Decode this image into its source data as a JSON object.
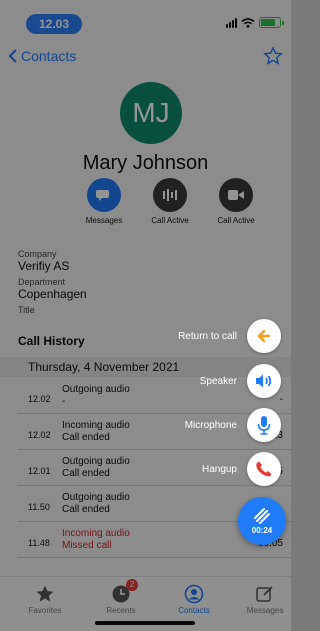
{
  "status": {
    "time": "12.03"
  },
  "nav": {
    "back_label": "Contacts"
  },
  "contact": {
    "initials": "MJ",
    "name": "Mary Johnson",
    "actions": [
      {
        "label": "Messages",
        "icon": "chat-bubble-icon"
      },
      {
        "label": "Call Active",
        "icon": "call-active-icon"
      },
      {
        "label": "Call Active",
        "icon": "video-icon"
      }
    ],
    "fields": [
      {
        "label": "Company",
        "value": "Verifiy AS"
      },
      {
        "label": "Department",
        "value": "Copenhagen"
      },
      {
        "label": "Title",
        "value": ""
      }
    ]
  },
  "history": {
    "title": "Call History",
    "date": "Thursday, 4 November 2021",
    "calls": [
      {
        "time": "12.02",
        "type": "Outgoing audio",
        "status": "-",
        "duration": "-",
        "missed": false
      },
      {
        "time": "12.02",
        "type": "Incoming audio",
        "status": "Call ended",
        "duration": "23",
        "missed": false
      },
      {
        "time": "12.01",
        "type": "Outgoing audio",
        "status": "Call ended",
        "duration": "05",
        "missed": false
      },
      {
        "time": "11.50",
        "type": "Outgoing audio",
        "status": "Call ended",
        "duration": "",
        "missed": false
      },
      {
        "time": "11.48",
        "type": "Incoming audio",
        "status": "Missed call",
        "duration": "00:05",
        "missed": true
      }
    ]
  },
  "fab_menu": {
    "return": {
      "label": "Return to call",
      "color": "#f39c1f"
    },
    "speaker": {
      "label": "Speaker",
      "color": "#1f7bf6"
    },
    "microphone": {
      "label": "Microphone",
      "color": "#1f7bf6"
    },
    "hangup": {
      "label": "Hangup",
      "color": "#e53935"
    },
    "timer": "00:24"
  },
  "tabs": [
    {
      "label": "Favorites",
      "icon": "star-icon",
      "active": false
    },
    {
      "label": "Recents",
      "icon": "clock-icon",
      "active": false,
      "badge": "2"
    },
    {
      "label": "Contacts",
      "icon": "person-icon",
      "active": true
    },
    {
      "label": "Messages",
      "icon": "compose-icon",
      "active": false
    }
  ]
}
